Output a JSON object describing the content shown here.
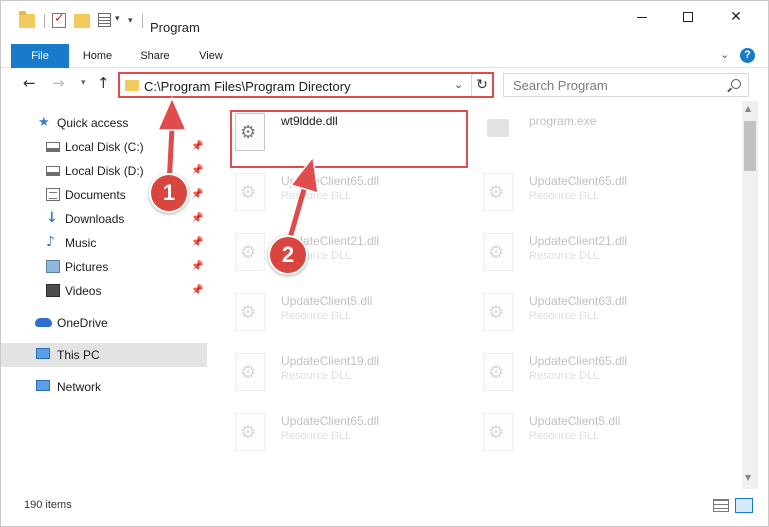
{
  "window": {
    "title": "Program",
    "controls": {
      "minimize": "—",
      "maximize": "☐",
      "close": "✕"
    }
  },
  "ribbon": {
    "tabs": [
      "File",
      "Home",
      "Share",
      "View"
    ],
    "expand": "⌄",
    "help": "?"
  },
  "address": {
    "path": "C:\\Program Files\\Program Directory",
    "chevron": "⌄",
    "refresh": "↻"
  },
  "search": {
    "placeholder": "Search Program"
  },
  "sidebar": {
    "items": [
      {
        "label": "Quick access",
        "icon": "star-icon"
      },
      {
        "label": "Local Disk (C:)",
        "icon": "disk-icon"
      },
      {
        "label": "Local Disk (D:)",
        "icon": "disk-icon"
      },
      {
        "label": "Documents",
        "icon": "documents-icon"
      },
      {
        "label": "Downloads",
        "icon": "download-icon"
      },
      {
        "label": "Music",
        "icon": "music-icon"
      },
      {
        "label": "Pictures",
        "icon": "pictures-icon"
      },
      {
        "label": "Videos",
        "icon": "videos-icon"
      },
      {
        "label": "OneDrive",
        "icon": "cloud-icon"
      },
      {
        "label": "This PC",
        "icon": "computer-icon"
      },
      {
        "label": "Network",
        "icon": "network-icon"
      }
    ],
    "pin_glyph": "📌"
  },
  "files": [
    {
      "name": "wt9ldde.dll",
      "type": ""
    },
    {
      "name": "program.exe",
      "type": ""
    },
    {
      "name": "UpdateClient65.dll",
      "type": "Resource DLL"
    },
    {
      "name": "UpdateClient65.dll",
      "type": "Resource DLL"
    },
    {
      "name": "UpdateClient21.dll",
      "type": "Resource DLL"
    },
    {
      "name": "UpdateClient21.dll",
      "type": "Resource DLL"
    },
    {
      "name": "UpdateClient5.dll",
      "type": "Resource DLL"
    },
    {
      "name": "UpdateClient63.dll",
      "type": "Resource DLL"
    },
    {
      "name": "UpdateClient19.dll",
      "type": "Resource DLL"
    },
    {
      "name": "UpdateClient65.dll",
      "type": "Resource DLL"
    },
    {
      "name": "UpdateClient65.dll",
      "type": "Resource DLL"
    },
    {
      "name": "UpdateClient5.dll",
      "type": "Resource DLL"
    }
  ],
  "status": {
    "item_count": "190 items"
  },
  "annotations": {
    "step1": "1",
    "step2": "2",
    "color": "#d9453f",
    "arrow_color": "#e04b4b"
  },
  "colors": {
    "accent": "#1979ca",
    "highlight": "#e04b4b"
  }
}
